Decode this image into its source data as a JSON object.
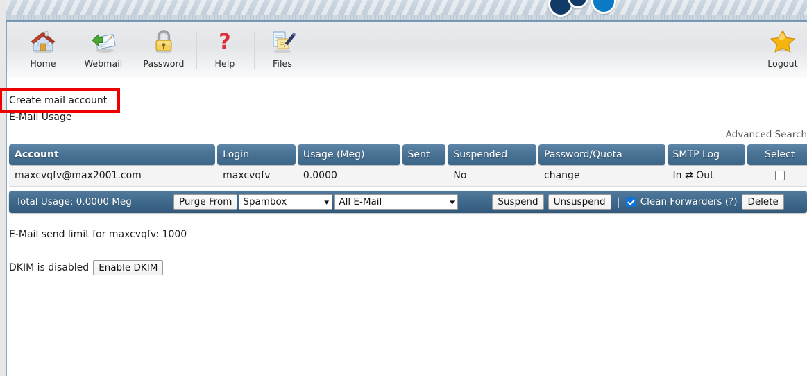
{
  "toolbar": {
    "items": [
      {
        "label": "Home",
        "icon": "home-icon"
      },
      {
        "label": "Webmail",
        "icon": "envelope-icon"
      },
      {
        "label": "Password",
        "icon": "padlock-icon"
      },
      {
        "label": "Help",
        "icon": "question-mark-icon"
      },
      {
        "label": "Files",
        "icon": "documents-pen-icon"
      }
    ],
    "logout": {
      "label": "Logout",
      "icon": "star-icon"
    }
  },
  "page": {
    "create_link": "Create mail account",
    "usage_heading": "E-Mail Usage",
    "advanced_search": "Advanced Search"
  },
  "table": {
    "headers": [
      "Account",
      "Login",
      "Usage (Meg)",
      "Sent",
      "Suspended",
      "Password/Quota",
      "SMTP Log",
      "Select"
    ],
    "rows": [
      {
        "account": "maxcvqfv@max2001.com",
        "login": "maxcvqfv",
        "usage": "0.0000",
        "sent": "",
        "suspended": "No",
        "password_quota": "change",
        "smtp_log": "In ⇄ Out",
        "selected": false
      }
    ]
  },
  "actionbar": {
    "total_usage": "Total Usage: 0.0000 Meg",
    "purge_from": "Purge From",
    "folder_select": {
      "value": "Spambox"
    },
    "scope_select": {
      "value": "All E-Mail"
    },
    "suspend": "Suspend",
    "unsuspend": "Unsuspend",
    "divider": "|",
    "clean_forwarders": "Clean Forwarders (?)",
    "clean_forwarders_checked": true,
    "delete": "Delete"
  },
  "footer": {
    "send_limit": "E-Mail send limit for maxcvqfv: 1000",
    "dkim_status": "DKIM is disabled",
    "dkim_button": "Enable DKIM"
  },
  "colors": {
    "header_blue": "#4a7294",
    "action_blue": "#3f6a8d",
    "annotation_red": "#ee0000",
    "checkbox_blue": "#1273d4"
  }
}
